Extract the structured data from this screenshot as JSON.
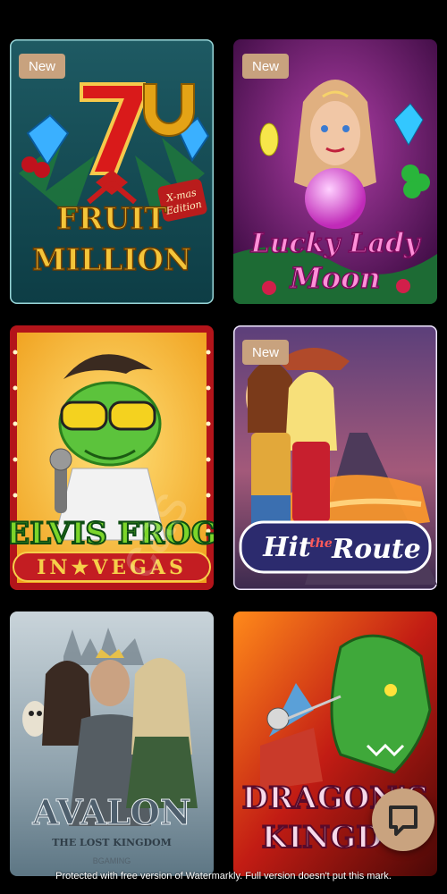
{
  "games": [
    {
      "id": "fruit-million",
      "title_line1": "FRUIT",
      "title_line2": "MILLION",
      "edition": "X-mas Edition",
      "badge": "New"
    },
    {
      "id": "lucky-lady-moon",
      "title_line1": "Lucky Lady",
      "title_line2": "Moon",
      "badge": "New"
    },
    {
      "id": "elvis-frog",
      "title_line1": "ELVIS FROG",
      "title_line2": "IN★VEGAS",
      "badge": ""
    },
    {
      "id": "hit-the-route",
      "title_line1": "Hit",
      "title_small": "the",
      "title_line2": "Route",
      "badge": "New"
    },
    {
      "id": "avalon",
      "title_line1": "AVALON",
      "title_line2": "THE LOST KINGDOM",
      "studio": "BGAMING",
      "badge": ""
    },
    {
      "id": "dragons-kingdom",
      "title_line1": "DRAGON'S",
      "title_line2": "KINGDO",
      "badge": ""
    }
  ],
  "colors": {
    "badge": "#c8a27e",
    "chat": "#c9a37f",
    "background": "#000000"
  },
  "chat": {
    "icon": "chat-bubble-icon"
  },
  "watermark": {
    "diagonal": "cas",
    "footer": "Protected with free version of Watermarkly. Full version doesn't put this mark."
  }
}
